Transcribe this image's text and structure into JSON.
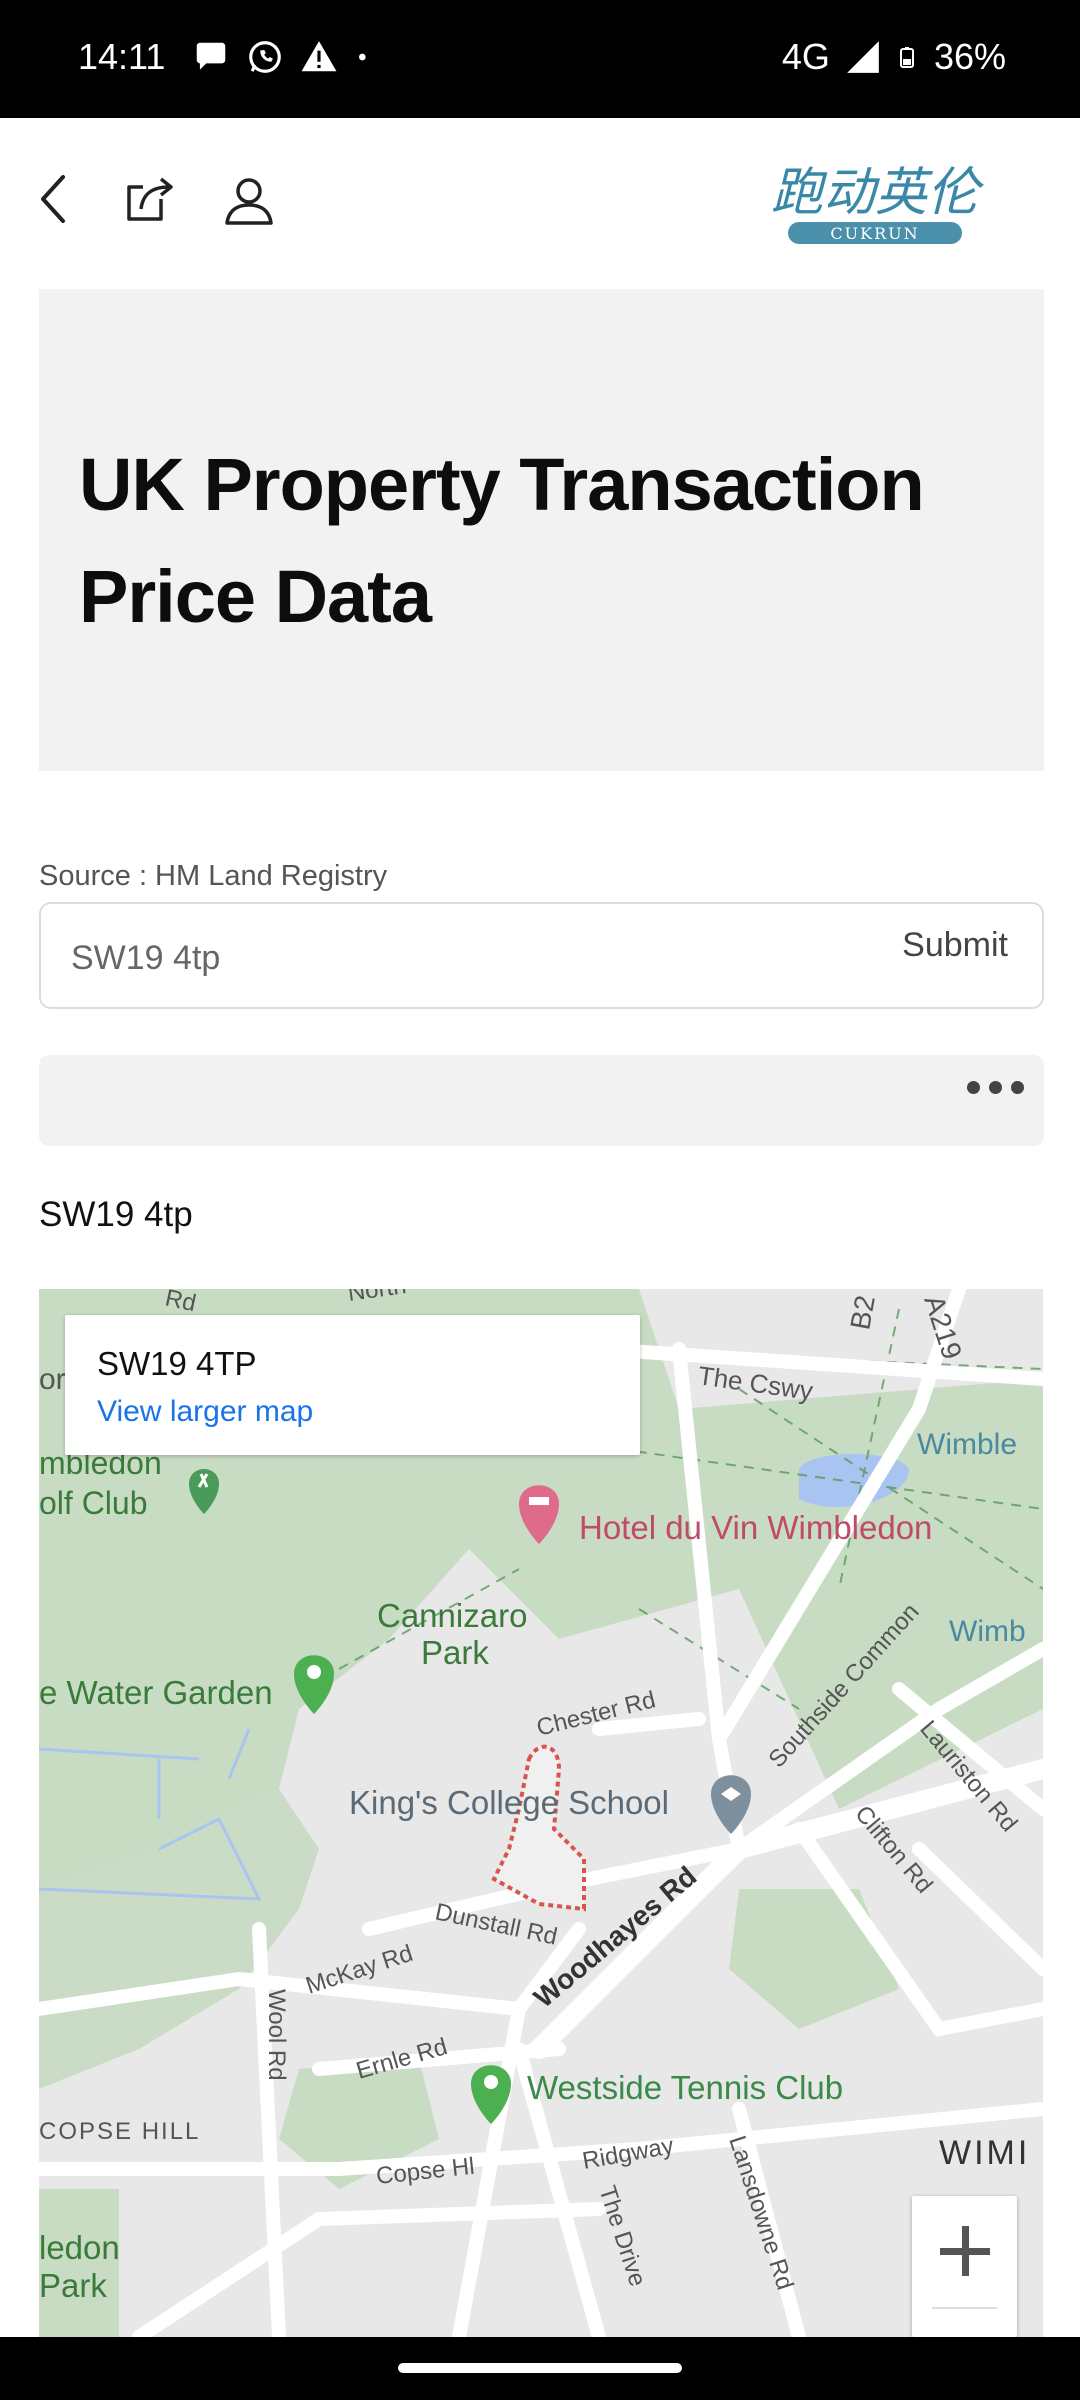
{
  "status_bar": {
    "time": "14:11",
    "network": "4G",
    "battery": "36%",
    "icons": [
      "message-icon",
      "whatsapp-icon",
      "warning-icon",
      "dot-icon",
      "signal-icon",
      "battery-icon"
    ]
  },
  "nav": {
    "back_icon": "back-arrow-icon",
    "share_icon": "share-icon",
    "profile_icon": "profile-icon",
    "logo_text": "跑动英伦",
    "logo_subtext": "CUKRUN"
  },
  "hero": {
    "title": "UK Property Transaction Price Data"
  },
  "search": {
    "source": "Source : HM Land Registry",
    "value": "SW19 4tp",
    "submit_label": "Submit"
  },
  "result": {
    "postcode": "SW19 4tp"
  },
  "map": {
    "card_title": "SW19 4TP",
    "card_link": "View larger map",
    "labels": {
      "cswy": "The Cswy",
      "wimbledon_1": "Wimble",
      "golf_club_1": "mbledon",
      "golf_club_2": "olf Club",
      "hotel": "Hotel du Vin Wimbledon",
      "cannizaro_1": "Cannizaro",
      "cannizaro_2": "Park",
      "wimb": "Wimb",
      "water_garden": "e Water Garden",
      "chester": "Chester Rd",
      "southside": "Southside Common",
      "lauriston": "Lauriston Rd",
      "school": "King's College School",
      "clifton": "Clifton Rd",
      "woodhayes": "Woodhayes Rd",
      "dunstall": "Dunstall Rd",
      "mckay": "McKay Rd",
      "wool": "Wool Rd",
      "ernle": "Ernle Rd",
      "tennis": "Westside Tennis Club",
      "copse_hill": "COPSE HILL",
      "copse_hl": "Copse Hl",
      "ridgway": "Ridgway",
      "drive": "The Drive",
      "lansdowne": "Lansdowne Rd",
      "wimi": "WIMI",
      "ledon_park_1": "ledon",
      "ledon_park_2": "Park",
      "b2": "B2",
      "a219": "A219",
      "north": "North",
      "rd_top": "Rd",
      "or": "or"
    },
    "colors": {
      "park": "#c8dcc4",
      "base": "#e8e8e8",
      "road": "#ffffff",
      "hotel_pin": "#e06a8a",
      "green_pin": "#4caf50",
      "school_pin": "#7e8f9e",
      "water": "#a9c4f0",
      "boundary": "#d9534f"
    }
  }
}
